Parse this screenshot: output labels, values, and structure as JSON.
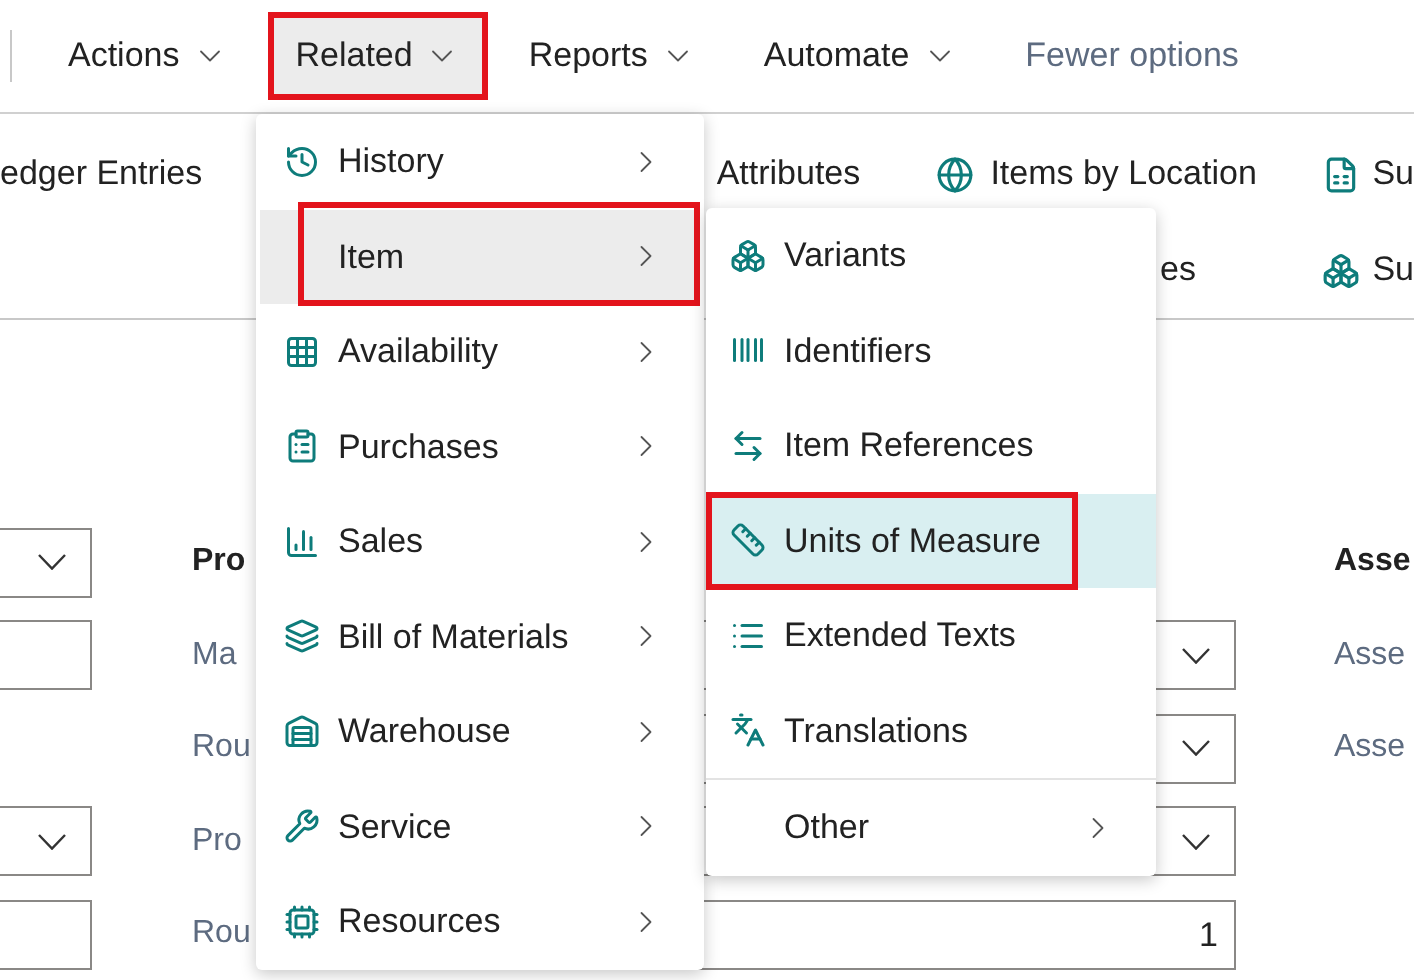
{
  "command_bar": {
    "items": [
      {
        "label": "Actions",
        "kind": "menu",
        "selected": false,
        "highlighted": false
      },
      {
        "label": "Related",
        "kind": "menu",
        "selected": true,
        "highlighted": true
      },
      {
        "label": "Reports",
        "kind": "menu",
        "selected": false,
        "highlighted": false
      },
      {
        "label": "Automate",
        "kind": "menu",
        "selected": false,
        "highlighted": false
      },
      {
        "label": "Fewer options",
        "kind": "link",
        "selected": false,
        "highlighted": false
      }
    ]
  },
  "ribbon": {
    "row_1": [
      "edger Entries",
      "Attributes",
      "Items by Location",
      "Su"
    ],
    "row_2": [
      "es",
      "Su"
    ]
  },
  "form": {
    "rows": [
      {
        "kind": "heading",
        "left_field": {
          "kind": "dropdown"
        },
        "label": "Pro",
        "right_label": "Asse"
      },
      {
        "kind": "field",
        "left_field": {
          "kind": "text"
        },
        "label": "Ma",
        "mid_field": {
          "kind": "dropdown"
        },
        "right_label": "Asse"
      },
      {
        "kind": "field",
        "label": "Rou",
        "mid_field": {
          "kind": "dropdown"
        },
        "right_label": "Asse"
      },
      {
        "kind": "field",
        "left_field": {
          "kind": "dropdown"
        },
        "label": "Pro",
        "mid_field": {
          "kind": "dropdown"
        }
      },
      {
        "kind": "field",
        "left_field": {
          "kind": "text"
        },
        "label": "Rou",
        "mid_field": {
          "kind": "text",
          "value": "1"
        }
      }
    ]
  },
  "related_menu": {
    "items": [
      {
        "label": "History",
        "selected": false,
        "highlighted": false
      },
      {
        "label": "Item",
        "selected": true,
        "highlighted": true
      },
      {
        "label": "Availability",
        "selected": false,
        "highlighted": false
      },
      {
        "label": "Purchases",
        "selected": false,
        "highlighted": false
      },
      {
        "label": "Sales",
        "selected": false,
        "highlighted": false
      },
      {
        "label": "Bill of Materials",
        "selected": false,
        "highlighted": false
      },
      {
        "label": "Warehouse",
        "selected": false,
        "highlighted": false
      },
      {
        "label": "Service",
        "selected": false,
        "highlighted": false
      },
      {
        "label": "Resources",
        "selected": false,
        "highlighted": false
      }
    ]
  },
  "item_submenu": {
    "items": [
      {
        "label": "Variants",
        "kind": "action",
        "selected": false,
        "highlighted": false
      },
      {
        "label": "Identifiers",
        "kind": "action",
        "selected": false,
        "highlighted": false
      },
      {
        "label": "Item References",
        "kind": "action",
        "selected": false,
        "highlighted": false
      },
      {
        "label": "Units of Measure",
        "kind": "action",
        "selected": true,
        "highlighted": true
      },
      {
        "label": "Extended Texts",
        "kind": "action",
        "selected": false,
        "highlighted": false
      },
      {
        "label": "Translations",
        "kind": "action",
        "selected": false,
        "highlighted": false
      },
      {
        "label": "Other",
        "kind": "submenu",
        "selected": false,
        "highlighted": false
      }
    ]
  }
}
